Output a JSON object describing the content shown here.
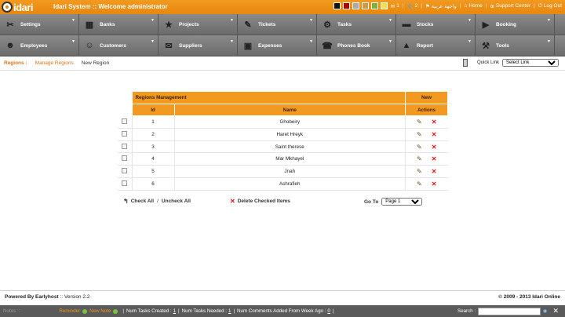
{
  "app": {
    "logo_text": "idari",
    "title": "Idari System :: Welcome administrator"
  },
  "topbar": {
    "swatches": [
      "#111111",
      "#aa0000",
      "#aaaaaa",
      "#c89a4a",
      "#7bb13c",
      "#f0e050"
    ],
    "counter_1": "1",
    "counter_2": "2",
    "language": "واجهة عربية",
    "home": "Home",
    "support": "Support Center",
    "logout": "Log Out"
  },
  "menu": [
    {
      "label": "Settings",
      "icon": "wrench-icon",
      "glyph": "✂"
    },
    {
      "label": "Banks",
      "icon": "bank-icon",
      "glyph": "▦"
    },
    {
      "label": "Projects",
      "icon": "star-icon",
      "glyph": "★"
    },
    {
      "label": "Tickets",
      "icon": "ticket-icon",
      "glyph": "✎"
    },
    {
      "label": "Tasks",
      "icon": "tasks-icon",
      "glyph": "⚙"
    },
    {
      "label": "Stocks",
      "icon": "truck-icon",
      "glyph": "▬"
    },
    {
      "label": "Booking",
      "icon": "booking-icon",
      "glyph": "▶"
    },
    {
      "label": "Employees",
      "icon": "employees-icon",
      "glyph": "☻"
    },
    {
      "label": "Customers",
      "icon": "customers-icon",
      "glyph": "☺"
    },
    {
      "label": "Suppliers",
      "icon": "suppliers-icon",
      "glyph": "✉"
    },
    {
      "label": "Expenses",
      "icon": "briefcase-icon",
      "glyph": "▣"
    },
    {
      "label": "Phones Book",
      "icon": "phone-icon",
      "glyph": "☎"
    },
    {
      "label": "Report",
      "icon": "chart-icon",
      "glyph": "▲"
    },
    {
      "label": "Tools",
      "icon": "tools-icon",
      "glyph": "⚒"
    }
  ],
  "crumbs": {
    "section": "Regions :",
    "manage": "Manage Regions",
    "new": "New Region"
  },
  "quick_link": {
    "label": "Quick Link",
    "value": "Select Link"
  },
  "table": {
    "title": "Regions Management",
    "new_label": "New",
    "col_id": "Id",
    "col_name": "Name",
    "col_actions": "Actions",
    "rows": [
      {
        "id": "1",
        "name": "Ghobeiry"
      },
      {
        "id": "2",
        "name": "Haret Hreyk"
      },
      {
        "id": "3",
        "name": "Saint therese"
      },
      {
        "id": "4",
        "name": "Mar Mkhayel"
      },
      {
        "id": "5",
        "name": "Jnah"
      },
      {
        "id": "6",
        "name": "Ashrafieh"
      }
    ]
  },
  "bulk": {
    "check_all": "Check All",
    "slash": "/",
    "uncheck_all": "Uncheck All",
    "delete_checked": "Delete Checked Items",
    "goto_label": "Go To",
    "page": "Page 1"
  },
  "footer": {
    "powered": "Powered By Earlyhost",
    "version": ":: Version 2.2",
    "copyright": "© 2009 - 2013 Idari Online"
  },
  "status": {
    "notes": "Notes ::",
    "reminder": "Reminder",
    "new_note": "New Note",
    "tasks_created_label": "Num Tasks Created :",
    "tasks_created": "1",
    "tasks_needed_label": "Num Tasks Needed :",
    "tasks_needed": "1",
    "comments_label": "Num Comments Added From Week Ago :",
    "comments": "0",
    "search_label": "Search :"
  }
}
